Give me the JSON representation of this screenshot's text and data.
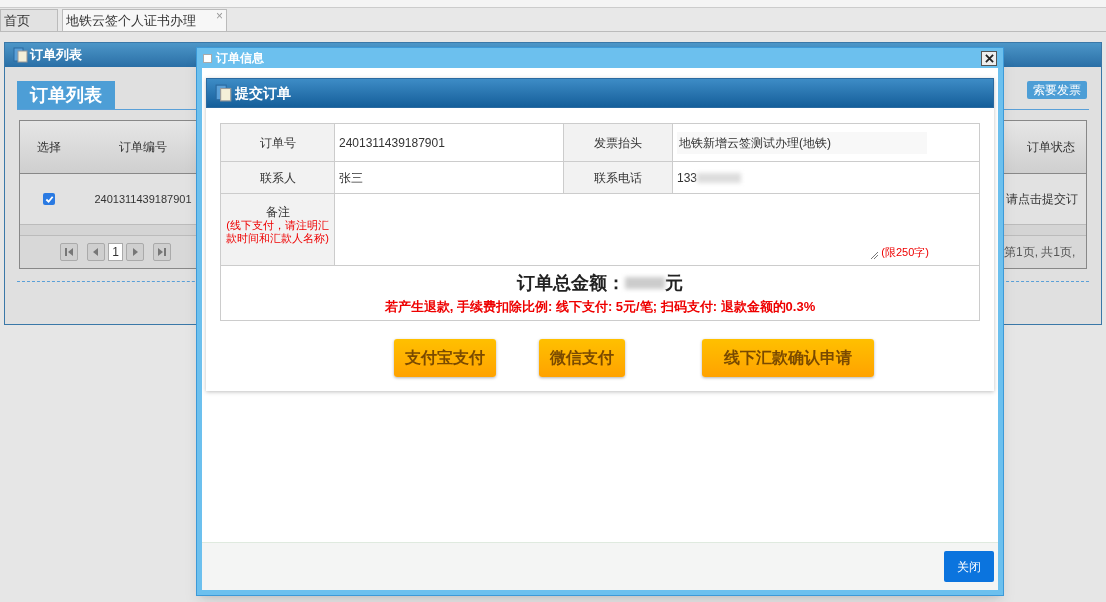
{
  "tabs": [
    {
      "label": "首页",
      "selected": false
    },
    {
      "label": "地铁云签个人证书办理",
      "selected": true,
      "close_glyph": "×"
    }
  ],
  "panel": {
    "title": "订单列表",
    "heading": "订单列表",
    "toolbar_buttons": [
      "索要发票"
    ],
    "table": {
      "columns": [
        "选择",
        "订单编号",
        "订单状态"
      ],
      "rows": [
        {
          "checked": true,
          "order_no": "2401311439187901",
          "status": "请点击提交订"
        }
      ]
    },
    "pager": {
      "page": "1",
      "summary": "第1页, 共1页,"
    }
  },
  "dialog": {
    "title": "订单信息",
    "card_title": "提交订单",
    "fields": [
      {
        "label": "订单号",
        "value": "2401311439187901",
        "kind": "text"
      },
      {
        "label": "发票抬头",
        "value": "地铁新增云签测试办理(地铁)",
        "kind": "input"
      },
      {
        "label": "联系人",
        "value": "张三",
        "kind": "text"
      },
      {
        "label": "联系电话",
        "value": "133",
        "kind": "redacted"
      }
    ],
    "remark": {
      "label": "备注",
      "hint": "(线下支付，请注明汇款时间和汇款人名称)",
      "limit": "(限250字)"
    },
    "total": {
      "label": "订单总金额：",
      "unit": "元"
    },
    "notice": "若产生退款, 手续费扣除比例: 线下支付: 5元/笔; 扫码支付: 退款金额的0.3%",
    "pay_buttons": [
      "支付宝支付",
      "微信支付",
      "线下汇款确认申请"
    ],
    "close_button": "关闭"
  }
}
